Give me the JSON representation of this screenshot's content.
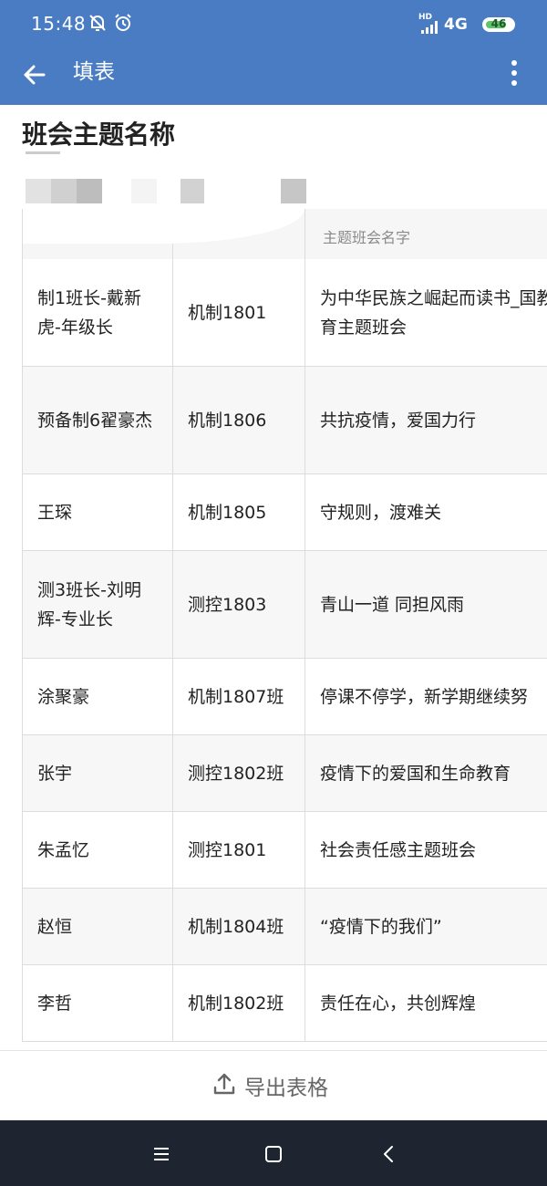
{
  "status_bar": {
    "time": "15:48",
    "hd_label": "HD",
    "network": "4G",
    "battery_level": "46",
    "icons": [
      "bell-off-icon",
      "alarm-icon",
      "signal-icon",
      "battery-icon"
    ]
  },
  "app_bar": {
    "title": "填表",
    "back_icon": "arrow-left-icon",
    "menu_icon": "more-vertical-icon",
    "color": "#4a7cc4"
  },
  "page": {
    "title": "班会主题名称"
  },
  "table": {
    "header_col3": "主题班会名字",
    "rows": [
      {
        "name": "制1班长-戴新虎-年级长",
        "class": "机制1801",
        "topic": "为中华民族之崛起而读书_国教育主题班会"
      },
      {
        "name": "预备制6翟豪杰",
        "class": "机制1806",
        "topic": "共抗疫情，爱国力行"
      },
      {
        "name": "王琛",
        "class": "机制1805",
        "topic": "守规则，渡难关"
      },
      {
        "name": "测3班长-刘明辉-专业长",
        "class": "测控1803",
        "topic": "青山一道 同担风雨"
      },
      {
        "name": "涂聚豪",
        "class": "机制1807班",
        "topic": "停课不停学，新学期继续努"
      },
      {
        "name": "张宇",
        "class": "测控1802班",
        "topic": "疫情下的爱国和生命教育"
      },
      {
        "name": "朱孟忆",
        "class": "测控1801",
        "topic": "社会责任感主题班会"
      },
      {
        "name": "赵恒",
        "class": "机制1804班",
        "topic": "“疫情下的我们”"
      },
      {
        "name": "李哲",
        "class": "机制1802班",
        "topic": "责任在心，共创辉煌"
      }
    ]
  },
  "export": {
    "label": "导出表格",
    "icon": "upload-icon"
  },
  "nav_bar": {
    "icons": [
      "menu-icon",
      "home-icon",
      "back-icon"
    ]
  }
}
